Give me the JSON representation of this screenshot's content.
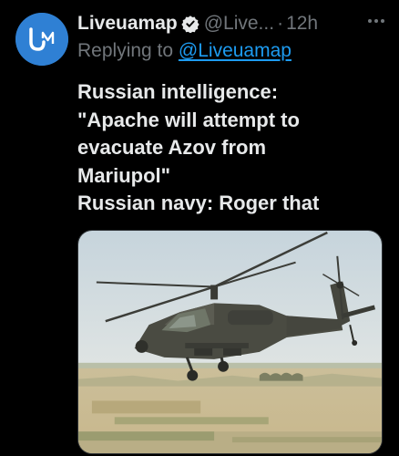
{
  "author": {
    "name": "Liveuamap",
    "handle": "@Live...",
    "separator": "·",
    "time": "12h"
  },
  "reply": {
    "prefix": "Replying to",
    "mention": "@Liveuamap"
  },
  "body": {
    "line1": "Russian intelligence:",
    "line2": "\"Apache will attempt to",
    "line3": "evacuate Azov from",
    "line4": "Mariupol\"",
    "line5": "Russian navy: Roger that"
  },
  "icons": {
    "avatar": "liveuamap-logo",
    "verified": "verified-badge-icon",
    "more": "more-options-icon"
  },
  "colors": {
    "background": "#000000",
    "text": "#e7e9ea",
    "secondary": "#71767b",
    "link": "#1d9bf0",
    "avatar": "#2f80d4"
  }
}
